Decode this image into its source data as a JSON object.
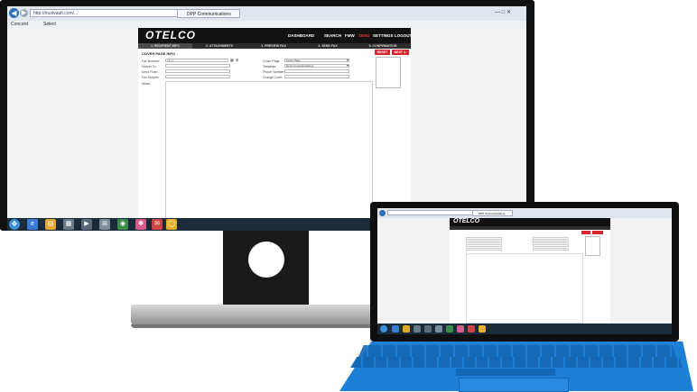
{
  "browser": {
    "address": "http://trustvault.com/...",
    "tab_title": "DPP Communications",
    "favorites": [
      "Concord",
      "Select"
    ],
    "window_controls": "— □ ✕"
  },
  "app": {
    "logo": "OTELCO",
    "nav": [
      "DASHBOARD",
      "SEARCH",
      "FMW",
      "SEND",
      "SETTINGS",
      "LOGOUT"
    ],
    "active_nav": "SEND",
    "steps": [
      "1. RECIPIENT INFO",
      "2. ATTACHMENTS",
      "3. PREVIEW FAX",
      "4. SEND FAX",
      "5. CONFIRMATION"
    ],
    "page_title": "COVER PAGE INFO",
    "reset_label": "RESET",
    "next_label": "NEXT ►",
    "fields_left": [
      {
        "label": "Fax Number:",
        "value": "+1 ( )"
      },
      {
        "label": "Deliver To:",
        "value": ""
      },
      {
        "label": "Send From:",
        "value": ""
      },
      {
        "label": "Fax Subject:",
        "value": ""
      }
    ],
    "fields_right": [
      {
        "label": "Cover Page:",
        "value": "Cover Page"
      },
      {
        "label": "Template:",
        "value": "Gmvt Communications"
      },
      {
        "label": "Phone Number:",
        "value": ""
      },
      {
        "label": "Charge Code:",
        "value": ""
      }
    ],
    "notes_label": "Notes:"
  },
  "taskbar": {
    "icons": [
      "ie-icon",
      "folder-icon",
      "explorer-icon",
      "media-icon",
      "calculator-icon",
      "network-icon",
      "paint-icon",
      "mail-icon",
      "chrome-icon"
    ]
  },
  "colors": {
    "accent": "#d7262e",
    "header": "#111111",
    "keyboard": "#1e7fd6"
  }
}
